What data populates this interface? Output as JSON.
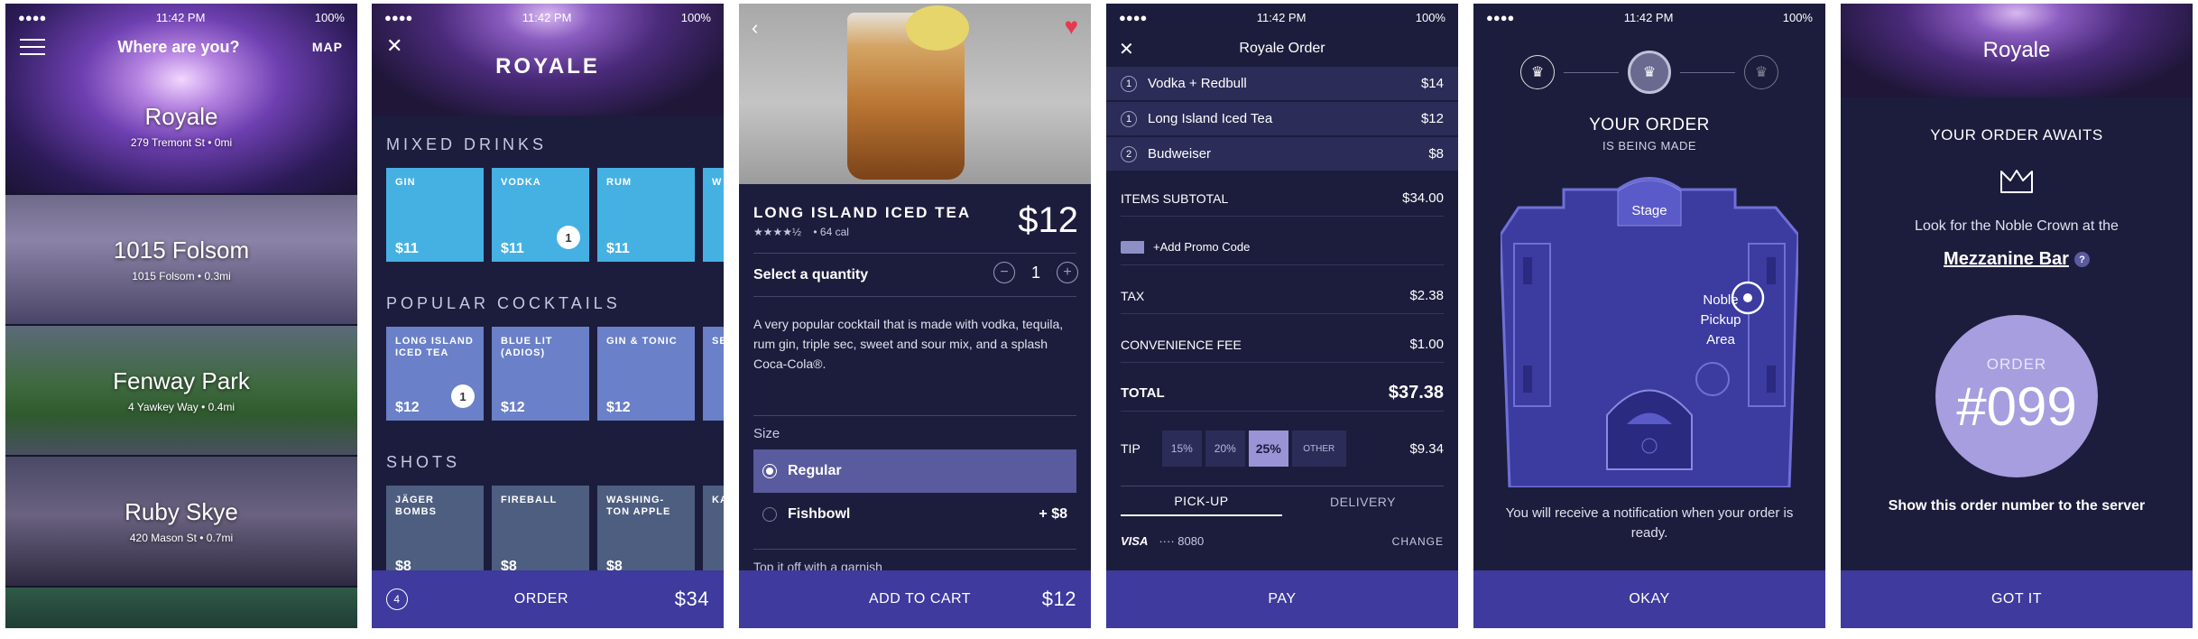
{
  "status": {
    "time": "11:42 PM",
    "battery": "100%",
    "signal": "●●●●"
  },
  "screen1": {
    "title": "Where are you?",
    "map_label": "MAP",
    "venues": [
      {
        "name": "Royale",
        "address": "279 Tremont St • 0mi"
      },
      {
        "name": "1015 Folsom",
        "address": "1015 Folsom • 0.3mi"
      },
      {
        "name": "Fenway Park",
        "address": "4 Yawkey Way • 0.4mi"
      },
      {
        "name": "Ruby Skye",
        "address": "420 Mason St • 0.7mi"
      }
    ]
  },
  "screen2": {
    "venue": "ROYALE",
    "categories": [
      {
        "label": "MIXED DRINKS",
        "items": [
          {
            "name": "GIN",
            "price": "$11",
            "badge": ""
          },
          {
            "name": "VODKA",
            "price": "$11",
            "badge": "1"
          },
          {
            "name": "RUM",
            "price": "$11",
            "badge": ""
          },
          {
            "name": "W",
            "price": "",
            "badge": ""
          }
        ]
      },
      {
        "label": "POPULAR COCKTAILS",
        "items": [
          {
            "name": "LONG ISLAND ICED TEA",
            "price": "$12",
            "badge": "1"
          },
          {
            "name": "BLUE LIT (ADIOS)",
            "price": "$12",
            "badge": ""
          },
          {
            "name": "GIN & TONIC",
            "price": "$12",
            "badge": ""
          },
          {
            "name": "SE BE",
            "price": "",
            "badge": ""
          }
        ]
      },
      {
        "label": "SHOTS",
        "items": [
          {
            "name": "JÄGER BOMBS",
            "price": "$8",
            "badge": ""
          },
          {
            "name": "FIREBALL",
            "price": "$8",
            "badge": ""
          },
          {
            "name": "WASHING-TON APPLE",
            "price": "$8",
            "badge": ""
          },
          {
            "name": "KA",
            "price": "",
            "badge": ""
          }
        ]
      }
    ],
    "cart_count": "4",
    "order_label": "ORDER",
    "total": "$34"
  },
  "screen3": {
    "drink_name": "LONG ISLAND ICED TEA",
    "stars": "★★★★½",
    "calories": "•    64 cal",
    "price": "$12",
    "qty_label": "Select a quantity",
    "qty_value": "1",
    "description": "A very popular cocktail that is made with vodka, tequila, rum gin, triple sec, sweet and sour mix, and a splash Coca-Cola®.",
    "size_label": "Size",
    "options": [
      {
        "label": "Regular",
        "extra": ""
      },
      {
        "label": "Fishbowl",
        "extra": "+ $8"
      }
    ],
    "garnish_label": "Top it off with a garnish",
    "add_label": "ADD TO CART",
    "add_price": "$12"
  },
  "screen4": {
    "title": "Royale Order",
    "items": [
      {
        "qty": "1",
        "name": "Vodka + Redbull",
        "price": "$14"
      },
      {
        "qty": "1",
        "name": "Long Island Iced Tea",
        "price": "$12"
      },
      {
        "qty": "2",
        "name": "Budweiser",
        "price": "$8"
      }
    ],
    "subtotal_label": "ITEMS SUBTOTAL",
    "subtotal": "$34.00",
    "promo_label": "+Add Promo Code",
    "tax_label": "TAX",
    "tax": "$2.38",
    "fee_label": "CONVENIENCE FEE",
    "fee": "$1.00",
    "total_label": "TOTAL",
    "total": "$37.38",
    "tip_label": "TIP",
    "tip_options": [
      "15%",
      "20%",
      "25%",
      "OTHER"
    ],
    "tip_amount": "$9.34",
    "tab_pickup": "PICK-UP",
    "tab_delivery": "DELIVERY",
    "card_brand": "VISA",
    "card_number": "···· 8080",
    "change_label": "CHANGE",
    "pay_label": "PAY"
  },
  "screen5": {
    "title": "YOUR ORDER",
    "subtitle": "IS BEING MADE",
    "stage_label": "Stage",
    "pickup_label": "Noble Pickup Area",
    "notification": "You will receive a notification when your order is ready.",
    "okay_label": "OKAY"
  },
  "screen6": {
    "venue": "Royale",
    "awaits": "YOUR ORDER AWAITS",
    "look_for": "Look for the Noble Crown at the",
    "location": "Mezzanine Bar",
    "help": "?",
    "order_label": "ORDER",
    "order_number": "#099",
    "show_text": "Show this order number to the server",
    "got_it_label": "GOT IT"
  }
}
